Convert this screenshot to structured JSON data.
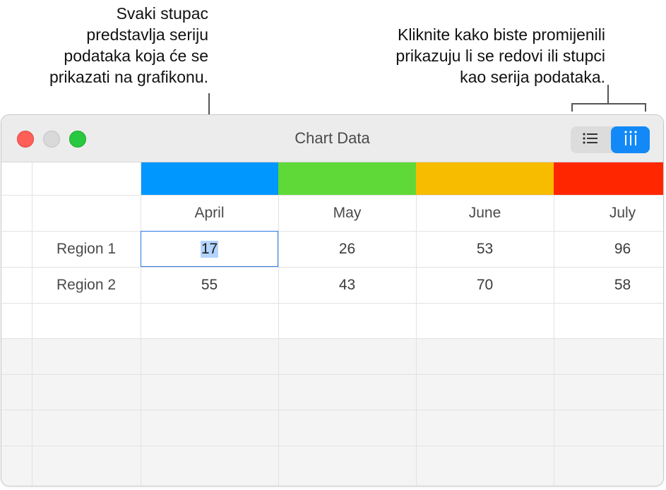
{
  "callouts": {
    "left": "Svaki stupac\npredstavlja seriju\npodataka koja će se\nprikazati na grafikonu.",
    "right": "Kliknite kako biste promijenili\nprikazuju li se redovi ili stupci\nkao serija podataka."
  },
  "window": {
    "title": "Chart Data",
    "toolbar": {
      "rows_icon": "list-icon",
      "columns_icon": "columns-icon"
    }
  },
  "table": {
    "columns": [
      {
        "label": "April",
        "color": "#0097ff"
      },
      {
        "label": "May",
        "color": "#5fd938"
      },
      {
        "label": "June",
        "color": "#f7bb00"
      },
      {
        "label": "July",
        "color": "#ff2600"
      }
    ],
    "rows": [
      {
        "label": "Region 1",
        "values": [
          "17",
          "26",
          "53",
          "96"
        ]
      },
      {
        "label": "Region 2",
        "values": [
          "55",
          "43",
          "70",
          "58"
        ]
      }
    ],
    "selected_cell": {
      "row": 0,
      "col": 0
    }
  }
}
